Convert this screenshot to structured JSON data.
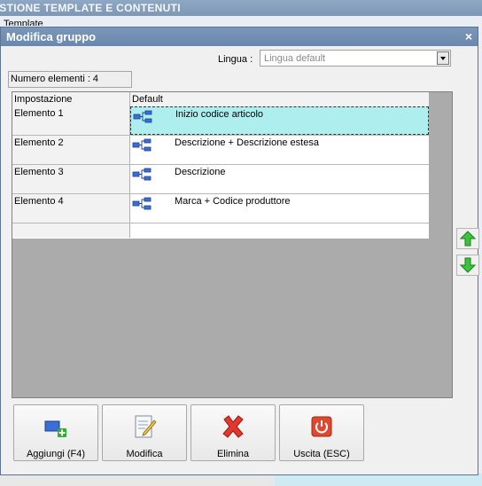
{
  "background": {
    "header_text": "ESTIONE TEMPLATE E CONTENUTI",
    "cut_text": "Template"
  },
  "dialog": {
    "title": "Modifica gruppo",
    "close_glyph": "×",
    "language": {
      "label": "Lingua :",
      "value": "Lingua default"
    },
    "count_label": "Numero elementi : 4",
    "grid": {
      "columns": [
        "Impostazione",
        "Default"
      ],
      "rows": [
        {
          "setting": "Elemento 1",
          "default": "Inizio codice articolo",
          "selected": true
        },
        {
          "setting": "Elemento 2",
          "default": "Descrizione + Descrizione estesa",
          "selected": false
        },
        {
          "setting": "Elemento 3",
          "default": "Descrizione",
          "selected": false
        },
        {
          "setting": "Elemento 4",
          "default": "Marca + Codice produttore",
          "selected": false
        }
      ]
    },
    "buttons": {
      "add": "Aggiungi (F4)",
      "edit": "Modifica",
      "delete": "Elimina",
      "exit": "Uscita (ESC)"
    },
    "icons": {
      "move_up": "arrow-up-icon",
      "move_down": "arrow-down-icon",
      "tree": "tree-node-icon"
    },
    "colors": {
      "selection": "#aeeeef",
      "title_bar": "#6a88ad",
      "arrow_green": "#2fae2f",
      "delete_red": "#e0382c"
    }
  }
}
